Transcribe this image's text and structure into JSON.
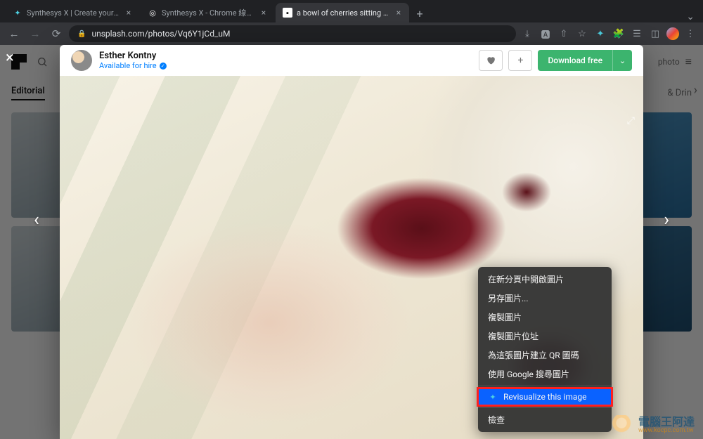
{
  "browser": {
    "tabs": [
      {
        "title": "Synthesys X | Create your own",
        "fav": "✦",
        "active": false
      },
      {
        "title": "Synthesys X - Chrome 線上應用",
        "fav": "◎",
        "active": false
      },
      {
        "title": "a bowl of cherries sitting on a t",
        "fav": "▣",
        "active": true
      }
    ],
    "url": "unsplash.com/photos/Vq6Y1jCd_uM"
  },
  "page": {
    "nav_active": "Editorial",
    "photo_label_partial": "photo",
    "nav_right_partial": "& Drin"
  },
  "modal": {
    "author_name": "Esther Kontny",
    "hire_text": "Available for hire",
    "download_label": "Download free"
  },
  "context_menu": {
    "items": [
      "在新分頁中開啟圖片",
      "另存圖片...",
      "複製圖片",
      "複製圖片位址",
      "為這張圖片建立 QR 圖碼",
      "使用 Google 搜尋圖片"
    ],
    "extension_item": "Revisualize this image",
    "inspect": "檢查"
  },
  "watermark": {
    "main": "電腦王阿達",
    "sub": "www.kocpc.com.tw"
  }
}
